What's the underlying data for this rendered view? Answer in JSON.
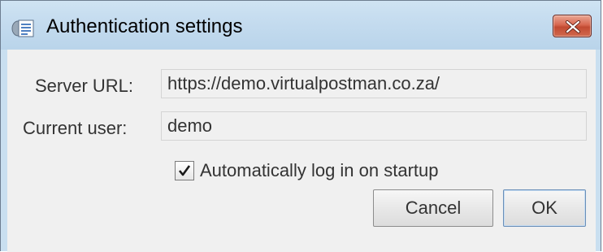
{
  "window": {
    "title": "Authentication settings",
    "icon": "app-document-icon",
    "close_icon": "close-icon"
  },
  "form": {
    "server_url_label": "Server URL:",
    "server_url_value": "https://demo.virtualpostman.co.za/",
    "current_user_label": "Current user:",
    "current_user_value": "demo",
    "auto_login_label": "Automatically log in on startup",
    "auto_login_checked": true
  },
  "buttons": {
    "cancel_label": "Cancel",
    "ok_label": "OK"
  },
  "colors": {
    "titlebar": "#c5dcef",
    "close_button": "#c7503a",
    "client_background": "#f0f0f0"
  }
}
